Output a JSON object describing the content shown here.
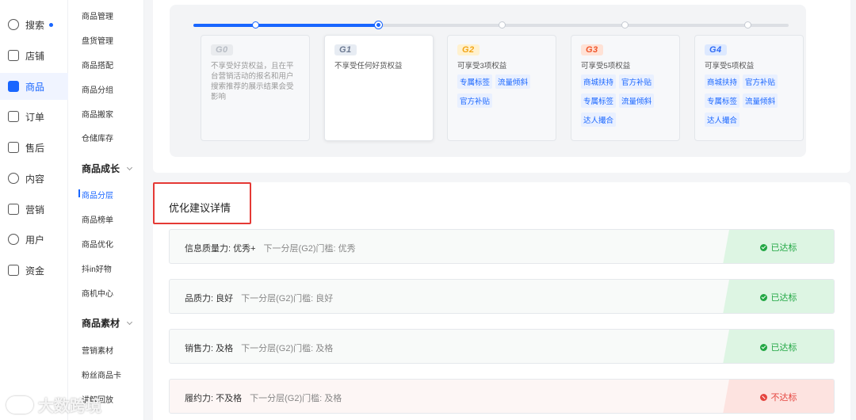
{
  "nav1": [
    {
      "label": "搜索",
      "icon": "search-chart-icon",
      "dot": true,
      "active": false
    },
    {
      "label": "店铺",
      "icon": "store-icon",
      "active": false
    },
    {
      "label": "商品",
      "icon": "goods-icon",
      "active": true
    },
    {
      "label": "订单",
      "icon": "order-icon",
      "active": false
    },
    {
      "label": "售后",
      "icon": "after-sale-icon",
      "active": false
    },
    {
      "label": "内容",
      "icon": "content-tv-icon",
      "active": false
    },
    {
      "label": "营销",
      "icon": "megaphone-icon",
      "active": false
    },
    {
      "label": "用户",
      "icon": "user-icon",
      "active": false
    },
    {
      "label": "资金",
      "icon": "wallet-icon",
      "active": false
    }
  ],
  "nav2": {
    "top_items": [
      "商品管理",
      "盘货管理",
      "商品搭配",
      "商品分组",
      "商品搬家",
      "仓储库存"
    ],
    "group_growth": "商品成长",
    "growth_items": [
      "商品分层",
      "商品榜单",
      "商品优化",
      "抖in好物",
      "商机中心"
    ],
    "group_material": "商品素材",
    "material_items": [
      "营销素材",
      "粉丝商品卡",
      "讲解回放"
    ]
  },
  "tiers": [
    {
      "badge": "G0",
      "desc": "不享受好货权益，且在平台营销活动的报名和用户搜索推荐的展示结果会受影响",
      "tags": []
    },
    {
      "badge": "G1",
      "desc": "不享受任何好货权益",
      "tags": []
    },
    {
      "badge": "G2",
      "desc": "可享受3项权益",
      "tags": [
        "专属标签",
        "流量倾斜",
        "官方补贴"
      ]
    },
    {
      "badge": "G3",
      "desc": "可享受5项权益",
      "tags": [
        "商城扶持",
        "官方补贴",
        "专属标签",
        "流量倾斜",
        "达人撮合"
      ]
    },
    {
      "badge": "G4",
      "desc": "可享受5项权益",
      "tags": [
        "商城扶持",
        "官方补贴",
        "专属标签",
        "流量倾斜",
        "达人撮合"
      ]
    }
  ],
  "progress": {
    "current_level": 1,
    "levels": 5
  },
  "section_title": "优化建议详情",
  "rows": [
    {
      "label": "信息质量力: 优秀+",
      "threshold": "下一分层(G2)门槛: 优秀",
      "status": "已达标",
      "ok": true
    },
    {
      "label": "品质力: 良好",
      "threshold": "下一分层(G2)门槛: 良好",
      "status": "已达标",
      "ok": true
    },
    {
      "label": "销售力: 及格",
      "threshold": "下一分层(G2)门槛: 及格",
      "status": "已达标",
      "ok": true
    },
    {
      "label": "履约力: 不及格",
      "threshold": "下一分层(G2)门槛: 及格",
      "status": "不达标",
      "ok": false
    }
  ],
  "watermark": "大数跨境",
  "colors": {
    "brand": "#1966ff",
    "ok": "#22a744",
    "bad": "#e5453f",
    "highlight_box": "#e53935"
  }
}
